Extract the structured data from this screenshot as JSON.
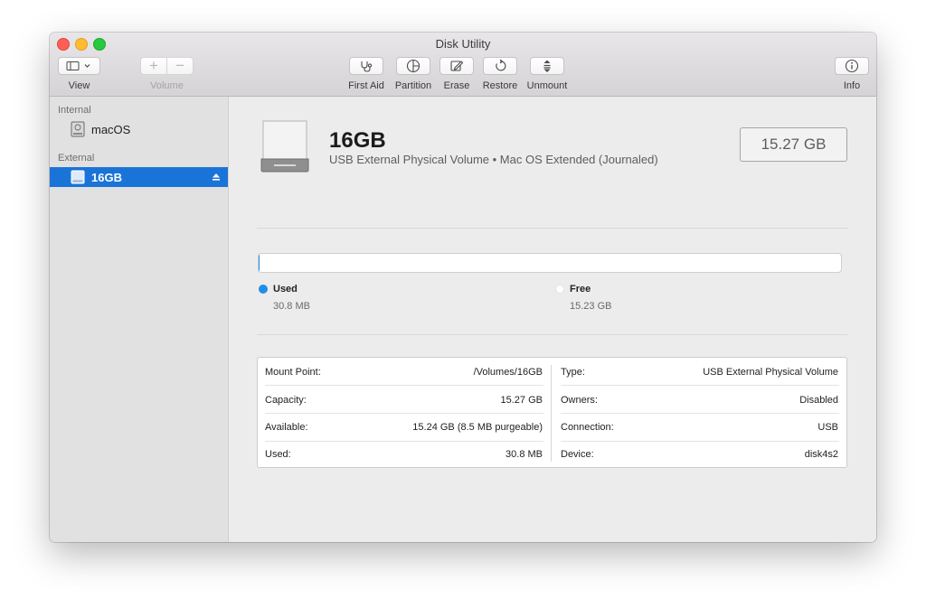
{
  "window": {
    "title": "Disk Utility"
  },
  "toolbar": {
    "view_label": "View",
    "volume_label": "Volume",
    "first_aid_label": "First Aid",
    "partition_label": "Partition",
    "erase_label": "Erase",
    "restore_label": "Restore",
    "unmount_label": "Unmount",
    "info_label": "Info"
  },
  "sidebar": {
    "internal_header": "Internal",
    "external_header": "External",
    "items": [
      {
        "label": "macOS",
        "section": "Internal",
        "icon": "internal-disk-icon"
      },
      {
        "label": "16GB",
        "section": "External",
        "icon": "external-disk-icon",
        "selected": true
      }
    ]
  },
  "volume": {
    "name": "16GB",
    "description": "USB External Physical Volume • Mac OS Extended (Journaled)",
    "capacity_display": "15.27 GB"
  },
  "usage": {
    "used_fraction": 0.002,
    "used_label": "Used",
    "used_value": "30.8 MB",
    "free_label": "Free",
    "free_value": "15.23 GB",
    "used_color": "#1f8ee8"
  },
  "info": {
    "left": [
      {
        "key": "Mount Point:",
        "value": "/Volumes/16GB"
      },
      {
        "key": "Capacity:",
        "value": "15.27 GB"
      },
      {
        "key": "Available:",
        "value": "15.24 GB (8.5 MB purgeable)"
      },
      {
        "key": "Used:",
        "value": "30.8 MB"
      }
    ],
    "right": [
      {
        "key": "Type:",
        "value": "USB External Physical Volume"
      },
      {
        "key": "Owners:",
        "value": "Disabled"
      },
      {
        "key": "Connection:",
        "value": "USB"
      },
      {
        "key": "Device:",
        "value": "disk4s2"
      }
    ]
  },
  "colors": {
    "selection": "#1a74d8",
    "accent": "#1f8ee8"
  }
}
